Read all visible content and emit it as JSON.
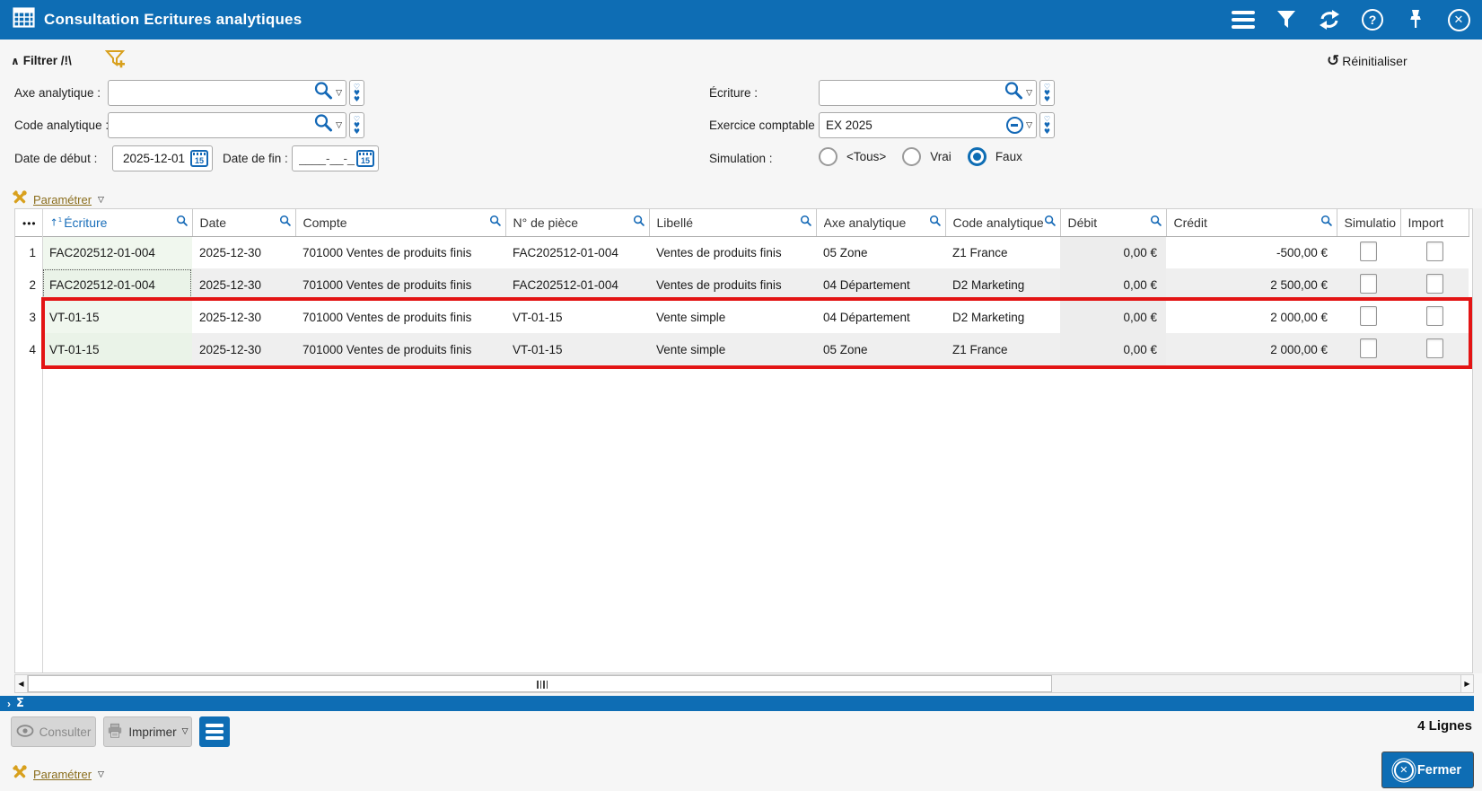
{
  "titlebar": {
    "title": "Consultation Ecritures analytiques"
  },
  "filter": {
    "collapse_glyph": "∧",
    "title": "Filtrer /!\\",
    "reset_label": "Réinitialiser",
    "axe_label": "Axe analytique :",
    "axe_value": "",
    "code_label": "Code analytique :",
    "code_value": "",
    "date_debut_label": "Date de début :",
    "date_debut_value": "2025-12-01",
    "date_fin_label": "Date de fin :",
    "date_fin_value": "____-__-__",
    "ecriture_label": "Écriture :",
    "ecriture_value": "",
    "exercice_label": "Exercice comptable :",
    "exercice_value": "EX 2025",
    "simulation_label": "Simulation :",
    "sim_options": [
      {
        "label": "<Tous>",
        "selected": false
      },
      {
        "label": "Vrai",
        "selected": false
      },
      {
        "label": "Faux",
        "selected": true
      }
    ]
  },
  "toolbar": {
    "parametrer_label": "Paramétrer"
  },
  "table": {
    "row_menu_glyph": "•••",
    "sort_arrow": "↑",
    "sort_order": "1",
    "columns": [
      {
        "label": "Écriture"
      },
      {
        "label": "Date"
      },
      {
        "label": "Compte"
      },
      {
        "label": "N° de pièce"
      },
      {
        "label": "Libellé"
      },
      {
        "label": "Axe analytique"
      },
      {
        "label": "Code analytique"
      },
      {
        "label": "Débit"
      },
      {
        "label": "Crédit"
      },
      {
        "label": "Simulatio"
      },
      {
        "label": "Import"
      }
    ],
    "rows": [
      {
        "num": "1",
        "ecriture": "FAC202512-01-004",
        "date": "2025-12-30",
        "compte": "701000 Ventes de produits finis",
        "piece": "FAC202512-01-004",
        "libelle": "Ventes de produits finis",
        "axe": "05 Zone",
        "code": "Z1 France",
        "debit": "0,00 €",
        "credit": "-500,00 €",
        "simulation": false,
        "import": false
      },
      {
        "num": "2",
        "ecriture": "FAC202512-01-004",
        "date": "2025-12-30",
        "compte": "701000 Ventes de produits finis",
        "piece": "FAC202512-01-004",
        "libelle": "Ventes de produits finis",
        "axe": "04 Département",
        "code": "D2 Marketing",
        "debit": "0,00 €",
        "credit": "2 500,00 €",
        "simulation": false,
        "import": false
      },
      {
        "num": "3",
        "ecriture": "VT-01-15",
        "date": "2025-12-30",
        "compte": "701000 Ventes de produits finis",
        "piece": "VT-01-15",
        "libelle": "Vente simple",
        "axe": "04 Département",
        "code": "D2 Marketing",
        "debit": "0,00 €",
        "credit": "2 000,00 €",
        "simulation": false,
        "import": false
      },
      {
        "num": "4",
        "ecriture": "VT-01-15",
        "date": "2025-12-30",
        "compte": "701000 Ventes de produits finis",
        "piece": "VT-01-15",
        "libelle": "Vente simple",
        "axe": "05 Zone",
        "code": "Z1 France",
        "debit": "0,00 €",
        "credit": "2 000,00 €",
        "simulation": false,
        "import": false
      }
    ]
  },
  "footer": {
    "sum_glyph": "Σ",
    "consulter_label": "Consulter",
    "imprimer_label": "Imprimer",
    "count_label": "4 Lignes",
    "parametrer_label": "Paramétrer",
    "fermer_label": "Fermer"
  },
  "colors": {
    "accent_blue": "#0e6db4",
    "annotation_red": "#e31414",
    "gold": "#d8a01d",
    "row_alt": "#efefef",
    "ecriture_green": "#f0f7ee"
  }
}
